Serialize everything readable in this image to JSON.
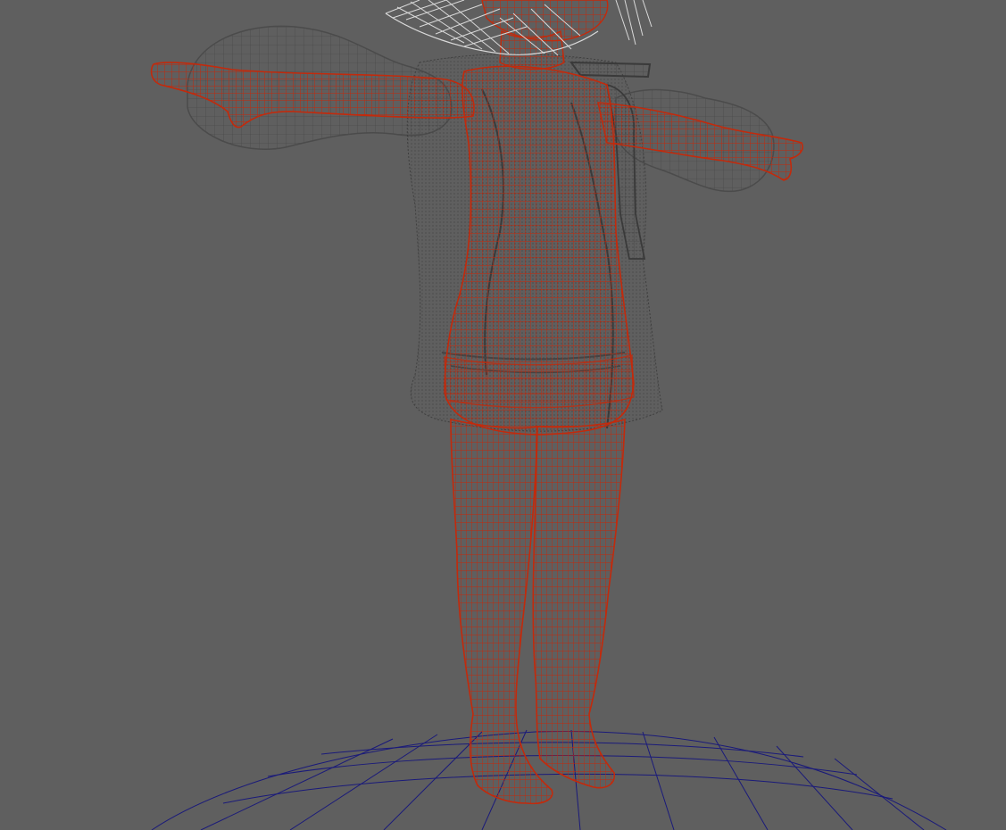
{
  "viewport": {
    "background": "#5f5f5f",
    "render_mode": "wireframe"
  },
  "colors": {
    "body_mesh": "#c22a0c",
    "clothing_mesh": "#4a4a4a",
    "clothing_dotted": "#3c3c3c",
    "hair_mesh": "#d9d9d9",
    "ground_grid": "#1a1a7a"
  },
  "objects": [
    {
      "name": "body-mesh",
      "color_key": "body_mesh",
      "selected": true
    },
    {
      "name": "clothing-mesh",
      "color_key": "clothing_mesh",
      "selected": false
    },
    {
      "name": "hair-mesh",
      "color_key": "hair_mesh",
      "selected": false
    },
    {
      "name": "ground-grid",
      "color_key": "ground_grid",
      "selected": false
    }
  ]
}
